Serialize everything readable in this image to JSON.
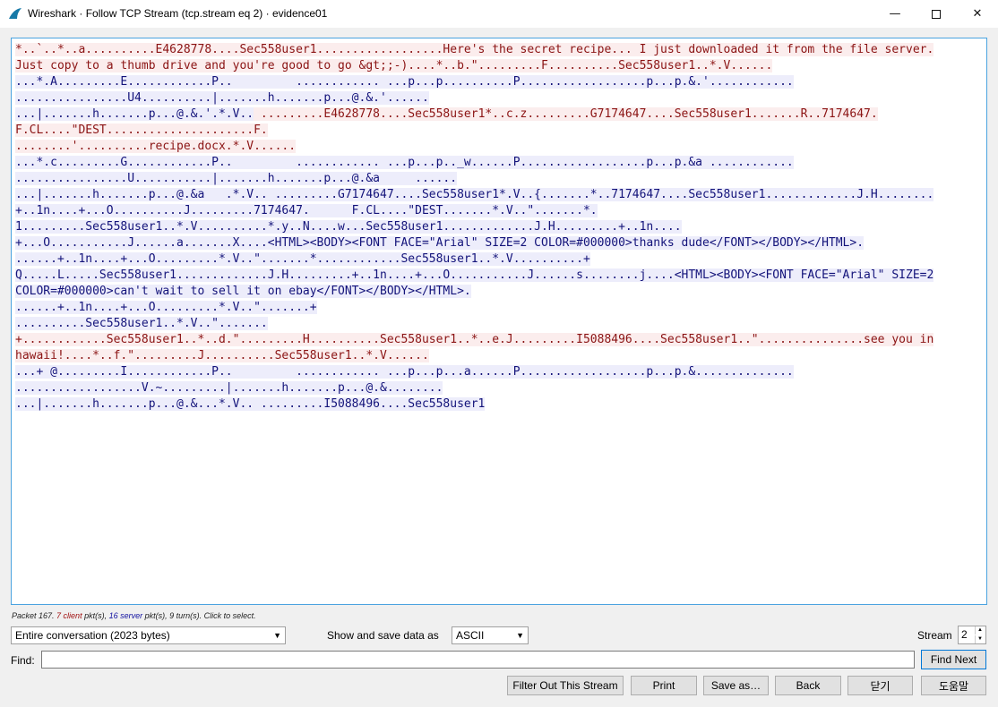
{
  "window": {
    "app": "Wireshark",
    "separator": " · ",
    "title": "Follow TCP Stream (tcp.stream eq 2) · evidence01",
    "controls": [
      "minimize",
      "maximize",
      "close"
    ]
  },
  "stream_lines": [
    {
      "dir": "client",
      "text": "*..`..*..a..........E4628778....Sec558user1..................Here's the secret recipe... I just downloaded it from the file server."
    },
    {
      "dir": "client",
      "text": "Just copy to a thumb drive and you're good to go &gt;;-)....*..b.\".........F..........Sec558user1..*.V......"
    },
    {
      "dir": "server",
      "text": "...*.A.........E............P..         ............ ...p...p..........P..................p...p.&.'............"
    },
    {
      "dir": "server",
      "text": "................U4..........|.......h.......p...@.&.'......"
    },
    {
      "dir": "server",
      "text": "...|.......h.......p...@.&.'.*.V..",
      "tail_dir": "client",
      "tail": " .........E4628778....Sec558user1*..c.z.........G7174647....Sec558user1.......R..7174647."
    },
    {
      "dir": "client",
      "text": "F.CL....\"DEST.....................F."
    },
    {
      "dir": "client",
      "text": "........'..........recipe.docx.*.V......"
    },
    {
      "dir": "server",
      "text": "...*.c.........G............P..         ............ ...p...p.._w......P..................p...p.&a ............"
    },
    {
      "dir": "server",
      "text": "................U...........|.......h.......p...@.&a     ......"
    },
    {
      "dir": "server",
      "text": "...|.......h.......p...@.&a   .*.V.. .........G7174647....Sec558user1*.V..{.......*..7174647....Sec558user1.............J.H........"
    },
    {
      "dir": "server",
      "text": "+..1n....+...O..........J.........7174647.      F.CL....\"DEST.......*.V..\".......*."
    },
    {
      "dir": "server",
      "text": "1.........Sec558user1..*.V..........*.y..N....w...Sec558user1.............J.H.........+..1n...."
    },
    {
      "dir": "server",
      "text": "+...O...........J......a.......X....<HTML><BODY><FONT FACE=\"Arial\" SIZE=2 COLOR=#000000>thanks dude</FONT></BODY></HTML>."
    },
    {
      "dir": "server",
      "text": "......+..1n....+...O.........*.V..\".......*............Sec558user1..*.V..........+"
    },
    {
      "dir": "server",
      "text": "Q.....L.....Sec558user1.............J.H.........+..1n....+...O...........J......s........j....<HTML><BODY><FONT FACE=\"Arial\" SIZE=2"
    },
    {
      "dir": "server",
      "text": "COLOR=#000000>can't wait to sell it on ebay</FONT></BODY></HTML>."
    },
    {
      "dir": "server",
      "text": "......+..1n....+...O.........*.V..\".......+"
    },
    {
      "dir": "server",
      "text": "..........Sec558user1..*.V..\"......."
    },
    {
      "dir": "client",
      "text": "+............Sec558user1..*..d.\".........H..........Sec558user1..*..e.J.........I5088496....Sec558user1..\"...............see you in"
    },
    {
      "dir": "client",
      "text": "hawaii!....*..f.\".........J..........Sec558user1..*.V......"
    },
    {
      "dir": "server",
      "text": "...+ @.........I............P..         ............ ...p...p...a......P..................p...p.&.............."
    },
    {
      "dir": "server",
      "text": "..................V.~.........|.......h.......p...@.&........"
    },
    {
      "dir": "server",
      "text": "...|.......h.......p...@.&...*.V.. .........I5088496....Sec558user1"
    }
  ],
  "packet_info": {
    "prefix": "Packet 167. ",
    "client": "7 client",
    "mid": " pkt(s), ",
    "server": "16 server",
    "suffix": " pkt(s), 9 turn(s). Click to select."
  },
  "controls": {
    "conversation": "Entire conversation (2023 bytes)",
    "show_label": "Show and save data as",
    "format": "ASCII",
    "stream_label": "Stream",
    "stream_value": "2",
    "find_label": "Find:",
    "find_value": "",
    "find_next": "Find Next"
  },
  "buttons": {
    "filter": "Filter Out This Stream",
    "print": "Print",
    "save": "Save as…",
    "back": "Back",
    "close": "닫기",
    "help": "도움말"
  },
  "colors": {
    "client_text": "#8b1414",
    "client_bg": "#fbeded",
    "server_text": "#13137a",
    "server_bg": "#ededfb",
    "border_accent": "#4aa3e0"
  }
}
